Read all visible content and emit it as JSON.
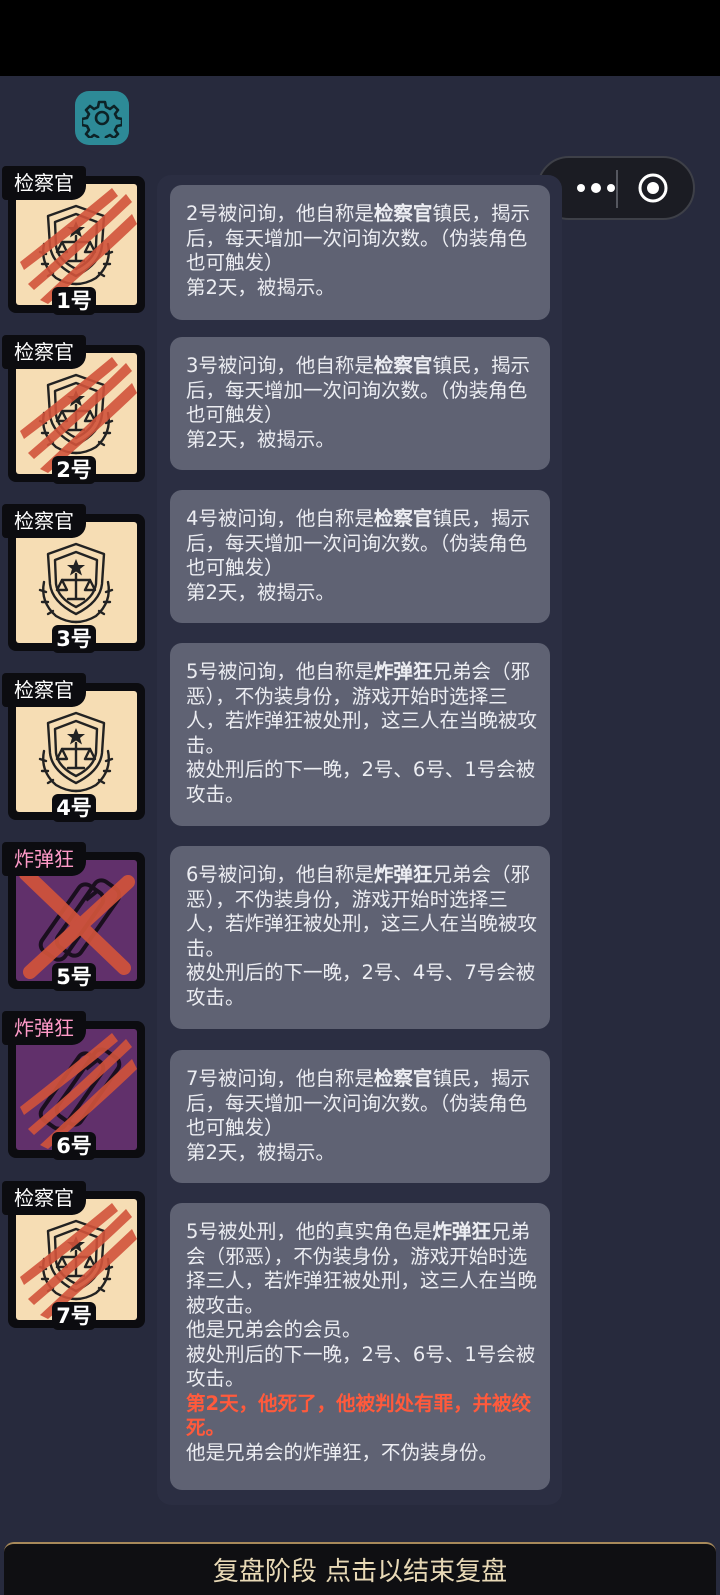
{
  "header": {
    "settings_icon": "gear-icon",
    "capsule": {
      "more_icon": "more-dots-icon",
      "close_icon": "target-circle-icon"
    }
  },
  "players": [
    {
      "role": "检察官",
      "number": "1号",
      "faction": "town",
      "status": "slashed"
    },
    {
      "role": "检察官",
      "number": "2号",
      "faction": "town",
      "status": "slashed"
    },
    {
      "role": "检察官",
      "number": "3号",
      "faction": "town",
      "status": "alive"
    },
    {
      "role": "检察官",
      "number": "4号",
      "faction": "town",
      "status": "alive"
    },
    {
      "role": "炸弹狂",
      "number": "5号",
      "faction": "brotherhood",
      "status": "executed"
    },
    {
      "role": "炸弹狂",
      "number": "6号",
      "faction": "brotherhood",
      "status": "slashed"
    },
    {
      "role": "检察官",
      "number": "7号",
      "faction": "town",
      "status": "slashed"
    }
  ],
  "log": [
    {
      "prefix": "2号被问询，他自称是",
      "role": "检察官",
      "lines": [
        "镇民，揭示后，每天增加一次问询次数。（伪装角色也可触发）",
        "第2天，被揭示。"
      ]
    },
    {
      "prefix": "3号被问询，他自称是",
      "role": "检察官",
      "lines": [
        "镇民，揭示后，每天增加一次问询次数。（伪装角色也可触发）",
        "第2天，被揭示。"
      ]
    },
    {
      "prefix": "4号被问询，他自称是",
      "role": "检察官",
      "lines": [
        "镇民，揭示后，每天增加一次问询次数。（伪装角色也可触发）",
        "第2天，被揭示。"
      ]
    },
    {
      "prefix": "5号被问询，他自称是",
      "role": "炸弹狂",
      "lines": [
        "兄弟会（邪恶），不伪装身份，游戏开始时选择三人，若炸弹狂被处刑，这三人在当晚被攻击。",
        "被处刑后的下一晚，2号、6号、1号会被攻击。"
      ]
    },
    {
      "prefix": "6号被问询，他自称是",
      "role": "炸弹狂",
      "lines": [
        "兄弟会（邪恶），不伪装身份，游戏开始时选择三人，若炸弹狂被处刑，这三人在当晚被攻击。",
        "被处刑后的下一晚，2号、4号、7号会被攻击。"
      ]
    },
    {
      "prefix": "7号被问询，他自称是",
      "role": "检察官",
      "lines": [
        "镇民，揭示后，每天增加一次问询次数。（伪装角色也可触发）",
        "第2天，被揭示。"
      ]
    },
    {
      "prefix": "5号被处刑，他的真实角色是",
      "role": "炸弹狂",
      "lines": [
        "兄弟会（邪恶），不伪装身份，游戏开始时选择三人，若炸弹狂被处刑，这三人在当晚被攻击。",
        "他是兄弟会的会员。",
        "被处刑后的下一晚，2号、6号、1号会被攻击。"
      ],
      "highlight": "第2天，他死了，他被判处有罪，并被绞死。",
      "tail": "他是兄弟会的炸弹狂，不伪装身份。"
    }
  ],
  "footer": {
    "label": "复盘阶段 点击以结束复盘"
  },
  "colors": {
    "town_bg": "#f6ddb4",
    "brotherhood_bg": "#61306b",
    "highlight": "#ff5a3c",
    "card_bg": "#5f6273"
  }
}
